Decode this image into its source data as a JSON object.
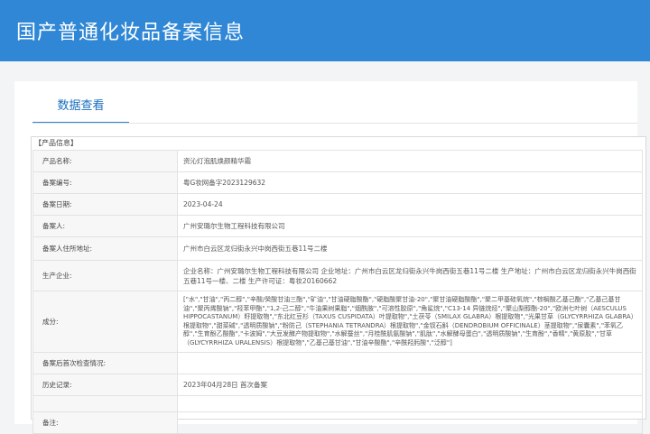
{
  "header": {
    "title": "国产普通化妆品备案信息"
  },
  "tabs": [
    {
      "label": "数据查看"
    }
  ],
  "section": {
    "title": "【产品信息】"
  },
  "rows": [
    {
      "label": "产品名称:",
      "value": "资沁灯泡肌焕颜精华霜"
    },
    {
      "label": "备案编号:",
      "value": "粤G妆网备字2023129632"
    },
    {
      "label": "备案日期:",
      "value": "2023-04-24"
    },
    {
      "label": "备案人:",
      "value": "广州安璐尔生物工程科技有限公司"
    },
    {
      "label": "备案人住所地址:",
      "value": "广州市白云区龙归街永兴中岗西街五巷11号二楼"
    },
    {
      "label": "生产企业:",
      "value": "企业名称：广州安璐尔生物工程科技有限公司 企业地址：广州市白云区龙归街永兴牛岗西街五巷11号二楼 生产地址：广州市白云区龙归街永兴牛岗西街五巷11号一楼、二楼 生产许可证：粤妆20160662"
    },
    {
      "label": "成分:",
      "value": "[\"水\",\"甘油\",\"丙二醇\",\"辛酸/癸酸甘油三酯\",\"矿油\",\"甘油硬脂酸酯\",\"硬脂酸聚甘油-20\",\"聚甘油硬脂酸酯\",\"聚二甲基硅氧烷\",\"棕榈酸乙基己酯\",\"乙基己基甘油\",\"聚丙烯酸钠\",\"羟苯甲酯\",\"1,2-己二醇\",\"牛油果树果脂\",\"烟酰胺\",\"可溶性胶原\",\"角鲨烷\",\"C13-14 异链烷烃\",\"聚山梨醇酯-20\",\"欧洲七叶树（AESCULUS HIPPOCASTANUM）籽提取物\",\"东北红豆杉（TAXUS CUSPIDATA）叶提取物\",\"土茯苓（SMILAX GLABRA）根提取物\",\"光果甘草（GLYCYRRHIZA GLABRA）根提取物\",\"甜菜碱\",\"透明质酸钠\",\"粉防己（STEPHANIA TETRANDRA）根提取物\",\"金钗石斛（DENDROBIUM OFFICINALE）茎提取物\",\"尿囊素\",\"苯氧乙醇\",\"生育酚乙酸酯\",\"卡波姆\",\"大豆发酵产物提取物\",\"水解蚕丝\",\"月桂酰肌氨酸钠\",\"肌肽\",\"水解酵母蛋白\",\"透明质酸钠\",\"生育酚\",\"香精\",\"黄原胶\",\"甘草（GLYCYRRHIZA URALENSIS）根提取物\",\"乙基己基甘油\",\"甘油辛酸酯\",\"辛酰羟肟酸\",\"泛醇\"]"
    },
    {
      "label": "备案后首次检查情况:",
      "value": ""
    },
    {
      "label": "历史记录:",
      "value": "2023年04月28日 首次备案"
    },
    {
      "label": "",
      "value": ""
    },
    {
      "label": "备注:",
      "value": ""
    }
  ]
}
